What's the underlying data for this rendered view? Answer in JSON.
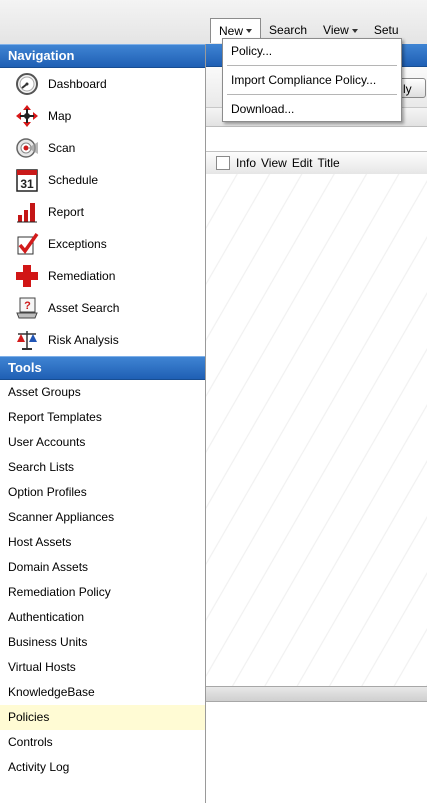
{
  "menubar": {
    "tabs": [
      {
        "label": "New",
        "has_caret": true,
        "open": true
      },
      {
        "label": "Search",
        "has_caret": false
      },
      {
        "label": "View",
        "has_caret": true
      },
      {
        "label": "Setu",
        "has_caret": false
      }
    ]
  },
  "dropdown": {
    "items": [
      {
        "label": "Policy..."
      },
      {
        "label": "Import Compliance Policy..."
      },
      {
        "label": "Download..."
      }
    ]
  },
  "navigation": {
    "title": "Navigation",
    "items": [
      {
        "label": "Dashboard",
        "icon": "dashboard-gauge-icon"
      },
      {
        "label": "Map",
        "icon": "map-arrows-icon"
      },
      {
        "label": "Scan",
        "icon": "scan-target-icon"
      },
      {
        "label": "Schedule",
        "icon": "calendar-icon"
      },
      {
        "label": "Report",
        "icon": "report-bars-icon"
      },
      {
        "label": "Exceptions",
        "icon": "exceptions-check-icon"
      },
      {
        "label": "Remediation",
        "icon": "remediation-cross-icon"
      },
      {
        "label": "Asset Search",
        "icon": "asset-search-laptop-icon"
      },
      {
        "label": "Risk Analysis",
        "icon": "risk-scales-icon"
      }
    ]
  },
  "tools": {
    "title": "Tools",
    "items": [
      {
        "label": "Asset Groups"
      },
      {
        "label": "Report Templates"
      },
      {
        "label": "User Accounts"
      },
      {
        "label": "Search Lists"
      },
      {
        "label": "Option Profiles"
      },
      {
        "label": "Scanner Appliances"
      },
      {
        "label": "Host Assets"
      },
      {
        "label": "Domain Assets"
      },
      {
        "label": "Remediation Policy"
      },
      {
        "label": "Authentication"
      },
      {
        "label": "Business Units"
      },
      {
        "label": "Virtual Hosts"
      },
      {
        "label": "KnowledgeBase"
      },
      {
        "label": "Policies",
        "active": true
      },
      {
        "label": "Controls"
      },
      {
        "label": "Activity Log"
      }
    ]
  },
  "icons": {
    "calendar_day": "31"
  },
  "main": {
    "apply_button": "ly",
    "grid_columns": [
      "Info",
      "View",
      "Edit",
      "Title"
    ]
  },
  "colors": {
    "header_blue": "#2b6fc4",
    "active_highlight": "#fffbd4"
  }
}
